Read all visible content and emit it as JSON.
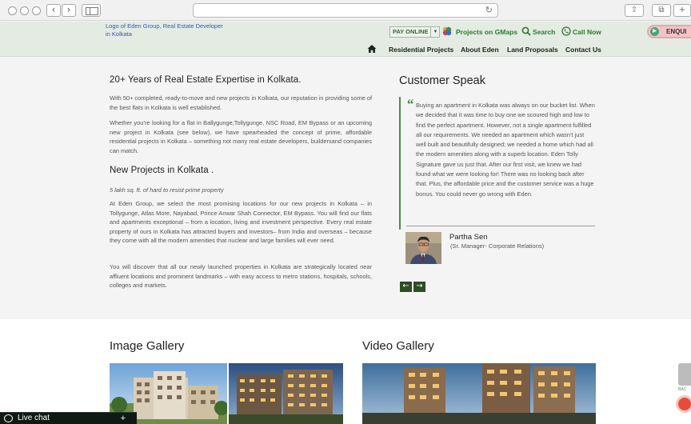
{
  "header": {
    "logo_alt": "Logo of Eden Group, Real Estate Developer in Kolkata",
    "pay_online": "PAY ONLINE",
    "links": {
      "gmaps": "Projects on GMaps",
      "search": "Search",
      "call": "Call Now"
    },
    "enquire": "ENQUI",
    "menu": [
      "Residential Projects",
      "About Eden",
      "Land Proposals",
      "Contact Us"
    ]
  },
  "main": {
    "expertise_title": "20+ Years of Real Estate Expertise in Kolkata.",
    "para1": "With 50+ completed, ready-to-move and new projects in Kolkata, our reputation in providing some of the best flats in Kolkata is well established.",
    "para2": "Whether you’re looking for a flat in Ballygunge,Tollygunge, NSC Road, EM Bypass or an upcoming new project in Kolkata (see below), we have spearheaded the concept of prime, affordable residential projects in Kolkata – something not many real estate developers, buildersand companies can match.",
    "new_projects_title": "New Projects in Kolkata .",
    "tagline": "5 lakh sq. ft. of hard to resist prime property",
    "para3": "At Eden Group, we select the most promising locations for our new projects in Kolkata – in Tollygunge, Atlas More, Nayabad, Prince Anwar Shah Connector, EM Bypass. You will find our flats and apartments exceptional – from a location, living and investment perspective. Every real estate property of ours in Kolkata has attracted buyers and investors– from India and overseas – because they come with all the modern amenities that nuclear and large families will ever need.",
    "para4": "You will discover that all our newly launched properties in Kolkata are strategically located near affluent locations and prominent landmarks – with easy access to metro stations, hospitals, schools, colleges and markets."
  },
  "testimonial": {
    "title": "Customer Speak",
    "quote": "Buying an apartment in Kolkata was always on our bucket list. When we decided that it was time to buy one we scoured high and low to find the perfect apartment. However, not a single apartment fulfilled all our requirements. We needed an apartment which wasn’t just well built and beautifully designed; we needed a home which had all the modern amenities along with a superb location. Eden Tolly Signature gave us just that. After our first visit, we knew we had found what we were looking for! There was no looking back after that. Plus, the affordable price and the customer service was a huge bonus. You could never go wrong with Eden.",
    "person_name": "Partha Sen",
    "person_role": "(Sr. Manager- Corporate Relations)"
  },
  "gallery": {
    "image_title": "Image Gallery",
    "video_title": "Video Gallery"
  },
  "livechat": {
    "label": "Live chat",
    "expand": "+"
  },
  "back_label": "BAC",
  "colors": {
    "header_bg": "#e3ebe3",
    "brand_green": "#2f7a2f",
    "dark_green": "#2d4d25",
    "enquire_pink": "#f3c3c8"
  }
}
